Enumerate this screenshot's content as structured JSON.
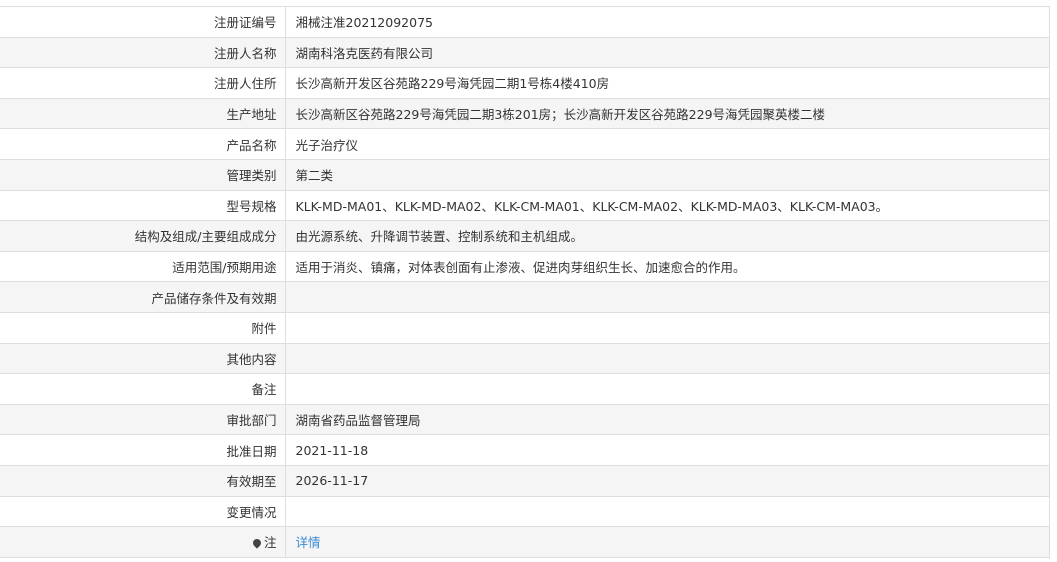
{
  "rows": [
    {
      "label": "注册证编号",
      "value": "湘械注准20212092075"
    },
    {
      "label": "注册人名称",
      "value": "湖南科洛克医药有限公司"
    },
    {
      "label": "注册人住所",
      "value": "长沙高新开发区谷苑路229号海凭园二期1号栋4楼410房"
    },
    {
      "label": "生产地址",
      "value": "长沙高新区谷苑路229号海凭园二期3栋201房；长沙高新开发区谷苑路229号海凭园聚英楼二楼"
    },
    {
      "label": "产品名称",
      "value": "光子治疗仪"
    },
    {
      "label": "管理类别",
      "value": "第二类"
    },
    {
      "label": "型号规格",
      "value": "KLK-MD-MA01、KLK-MD-MA02、KLK-CM-MA01、KLK-CM-MA02、KLK-MD-MA03、KLK-CM-MA03。"
    },
    {
      "label": "结构及组成/主要组成成分",
      "value": "由光源系统、升降调节装置、控制系统和主机组成。"
    },
    {
      "label": "适用范围/预期用途",
      "value": "适用于消炎、镇痛，对体表创面有止渗液、促进肉芽组织生长、加速愈合的作用。"
    },
    {
      "label": "产品储存条件及有效期",
      "value": ""
    },
    {
      "label": "附件",
      "value": ""
    },
    {
      "label": "其他内容",
      "value": ""
    },
    {
      "label": "备注",
      "value": ""
    },
    {
      "label": "审批部门",
      "value": "湖南省药品监督管理局"
    },
    {
      "label": "批准日期",
      "value": "2021-11-18"
    },
    {
      "label": "有效期至",
      "value": "2026-11-17"
    },
    {
      "label": "变更情况",
      "value": ""
    },
    {
      "label": "注",
      "value": "详情",
      "icon": "pin-icon"
    }
  ],
  "colors": {
    "stripe": "#f5f5f5",
    "border": "#dedede",
    "link": "#3b8bd6",
    "text": "#333333"
  }
}
